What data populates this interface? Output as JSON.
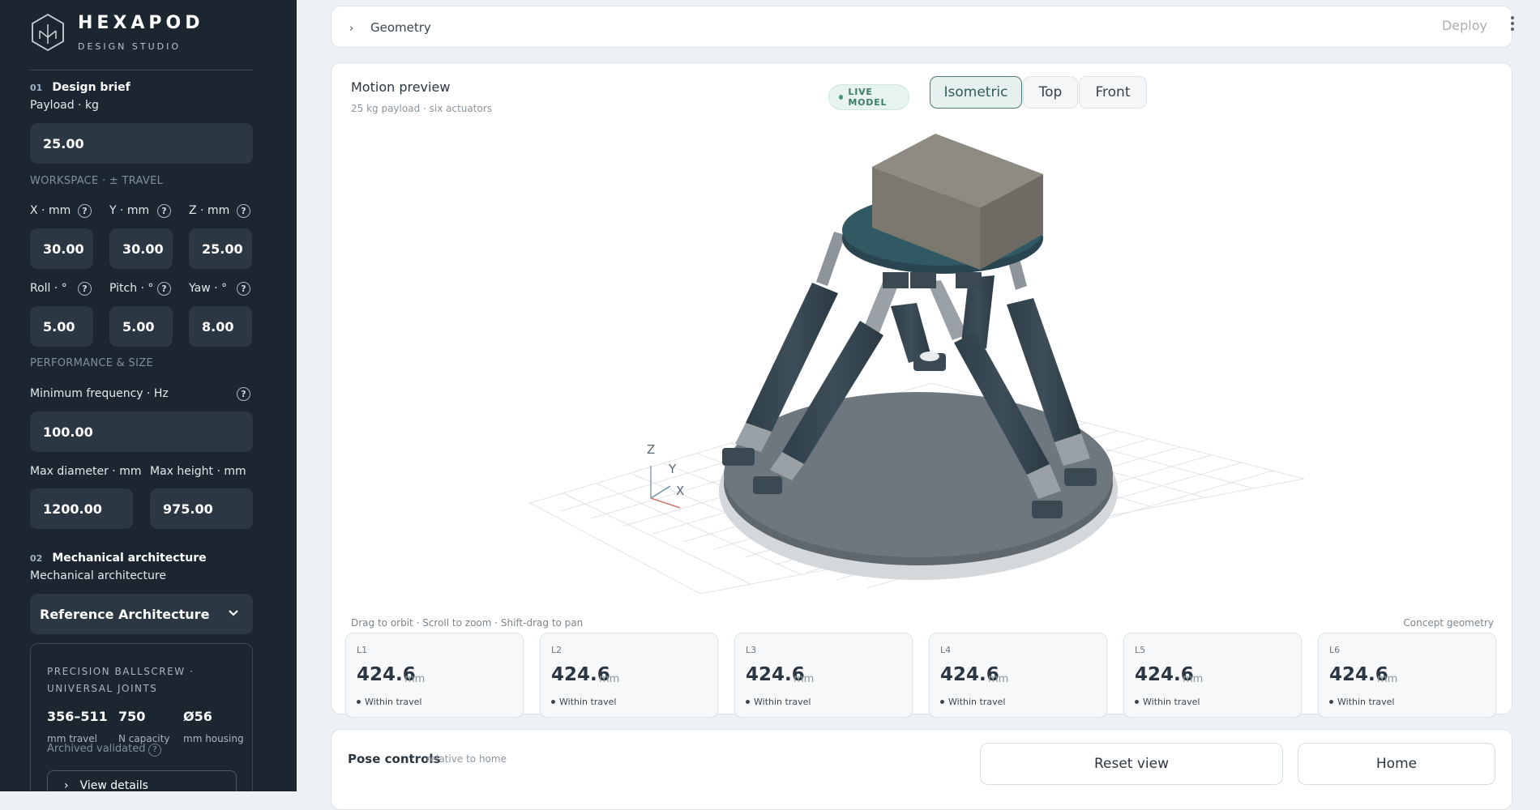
{
  "brand": {
    "name": "HEXAPOD",
    "subtitle": "DESIGN STUDIO"
  },
  "design_brief": {
    "num": "01",
    "title": "Design brief",
    "payload_label": "Payload · kg",
    "payload_value": "25.00",
    "workspace_caption": "WORKSPACE · ± TRAVEL",
    "x_label": "X · mm",
    "x_value": "30.00",
    "y_label": "Y · mm",
    "y_value": "30.00",
    "z_label": "Z · mm",
    "z_value": "25.00",
    "roll_label": "Roll · °",
    "roll_value": "5.00",
    "pitch_label": "Pitch · °",
    "pitch_value": "5.00",
    "yaw_label": "Yaw · °",
    "yaw_value": "8.00",
    "performance_caption": "PERFORMANCE & SIZE",
    "freq_label": "Minimum frequency · Hz",
    "freq_value": "100.00",
    "diam_label": "Max diameter · mm",
    "diam_value": "1200.00",
    "height_label": "Max height · mm",
    "height_value": "975.00"
  },
  "mechanical": {
    "num": "02",
    "title": "Mechanical architecture",
    "field_label": "Mechanical architecture",
    "selected": "Reference Architecture",
    "card": {
      "title": "PRECISION BALLSCREW · UNIVERSAL JOINTS",
      "stats": [
        {
          "value": "356–511",
          "label": "mm travel"
        },
        {
          "value": "750",
          "label": "N capacity"
        },
        {
          "value": "Ø56",
          "label": "mm housing"
        }
      ],
      "note": "Archived validated",
      "details": "View details"
    }
  },
  "geometry": {
    "title": "Geometry",
    "deploy": "Deploy"
  },
  "preview": {
    "title": "Motion preview",
    "subtitle": "25 kg payload · six actuators",
    "live": "LIVE MODEL",
    "views": [
      "Isometric",
      "Top",
      "Front"
    ],
    "active_view": "Isometric",
    "axes": {
      "z": "Z",
      "y": "Y",
      "x": "X"
    },
    "hint": "Drag to orbit · Scroll to zoom · Shift-drag to pan",
    "concept": "Concept geometry",
    "legs": [
      {
        "id": "L1",
        "value": "424.6",
        "unit": "mm",
        "status": "Within travel"
      },
      {
        "id": "L2",
        "value": "424.6",
        "unit": "mm",
        "status": "Within travel"
      },
      {
        "id": "L3",
        "value": "424.6",
        "unit": "mm",
        "status": "Within travel"
      },
      {
        "id": "L4",
        "value": "424.6",
        "unit": "mm",
        "status": "Within travel"
      },
      {
        "id": "L5",
        "value": "424.6",
        "unit": "mm",
        "status": "Within travel"
      },
      {
        "id": "L6",
        "value": "424.6",
        "unit": "mm",
        "status": "Within travel"
      }
    ]
  },
  "pose": {
    "title": "Pose controls",
    "subtitle": "relative to home",
    "reset": "Reset view",
    "home": "Home"
  },
  "colors": {
    "sidebar": "#1b2631",
    "field": "#2b3743",
    "accent": "#4d7a72",
    "live": "#3e7d64"
  }
}
